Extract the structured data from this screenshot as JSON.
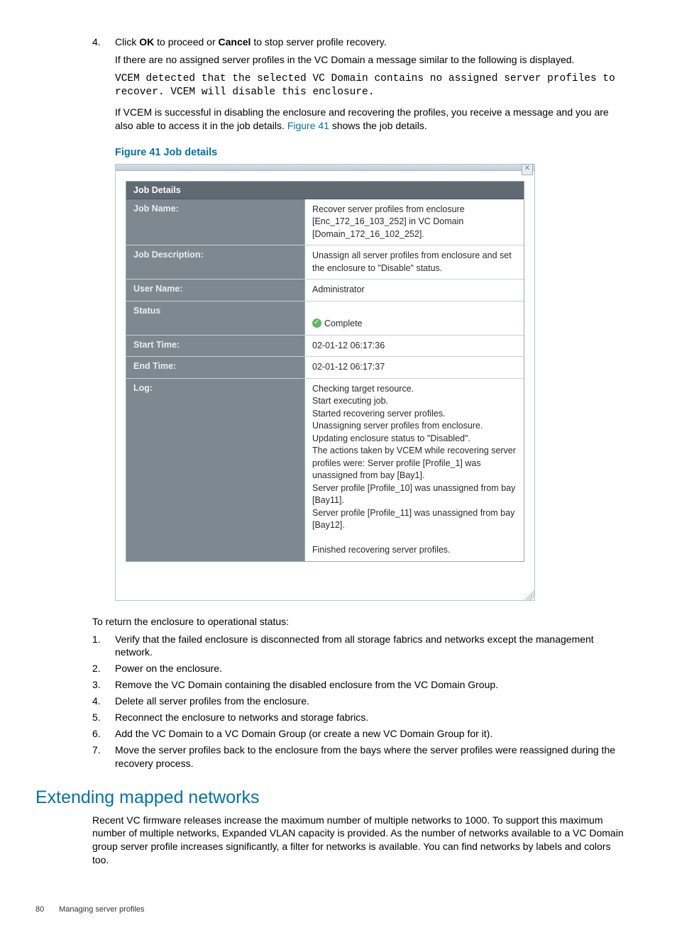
{
  "step4": {
    "num": "4.",
    "text_pre": "Click ",
    "ok": "OK",
    "text_mid": " to proceed or ",
    "cancel": "Cancel",
    "text_post": " to stop server profile recovery.",
    "para1": "If there are no assigned server profiles in the VC Domain a message similar to the following is displayed.",
    "code": "VCEM detected that the selected VC Domain contains no assigned server profiles to recover. VCEM will disable this enclosure.",
    "para2_pre": "If VCEM is successful in disabling the enclosure and recovering the profiles, you receive a message and you are also able to access it in the job details. ",
    "para2_link": "Figure 41",
    "para2_post": " shows the job details."
  },
  "figure_caption": "Figure 41 Job details",
  "panel": {
    "title": "Job Details",
    "rows": {
      "jobname": {
        "label": "Job Name:",
        "value": "Recover server profiles from enclosure [Enc_172_16_103_252] in VC Domain [Domain_172_16_102_252]."
      },
      "jobdesc": {
        "label": "Job Description:",
        "value": "Unassign all server profiles from enclosure and set the enclosure to \"Disable\" status."
      },
      "username": {
        "label": "User Name:",
        "value": "Administrator"
      },
      "status": {
        "label": "Status",
        "value": "Complete"
      },
      "start": {
        "label": "Start Time:",
        "value": "02-01-12 06:17:36"
      },
      "end": {
        "label": "End Time:",
        "value": "02-01-12 06:17:37"
      },
      "log": {
        "label": "Log:",
        "value": "Checking target resource.\nStart executing job.\nStarted recovering server profiles.\nUnassigning server profiles from enclosure.\nUpdating enclosure status to \"Disabled\".\nThe actions taken by VCEM while recovering server profiles were: Server profile [Profile_1] was unassigned from bay [Bay1].\nServer profile [Profile_10] was unassigned from bay [Bay11].\nServer profile [Profile_11] was unassigned from bay [Bay12].\n\nFinished recovering server profiles."
      }
    }
  },
  "return_intro": "To return the enclosure to operational status:",
  "steps": [
    {
      "num": "1.",
      "text": "Verify that the failed enclosure is disconnected from all storage fabrics and networks except the management network."
    },
    {
      "num": "2.",
      "text": "Power on the enclosure."
    },
    {
      "num": "3.",
      "text": "Remove the VC Domain containing the disabled enclosure from the VC Domain Group."
    },
    {
      "num": "4.",
      "text": "Delete all server profiles from the enclosure."
    },
    {
      "num": "5.",
      "text": "Reconnect the enclosure to networks and storage fabrics."
    },
    {
      "num": "6.",
      "text": "Add the VC Domain to a VC Domain Group (or create a new VC Domain Group for it)."
    },
    {
      "num": "7.",
      "text": "Move the server profiles back to the enclosure from the bays where the server profiles were reassigned during the recovery process."
    }
  ],
  "section_heading": "Extending mapped networks",
  "section_para": "Recent VC firmware releases increase the maximum number of multiple networks to 1000. To support this maximum number of multiple networks, Expanded VLAN capacity is provided. As the number of networks available to a VC Domain group server profile increases significantly, a filter for networks is available. You can find networks by labels and colors too.",
  "footer": {
    "page": "80",
    "title": "Managing server profiles"
  }
}
